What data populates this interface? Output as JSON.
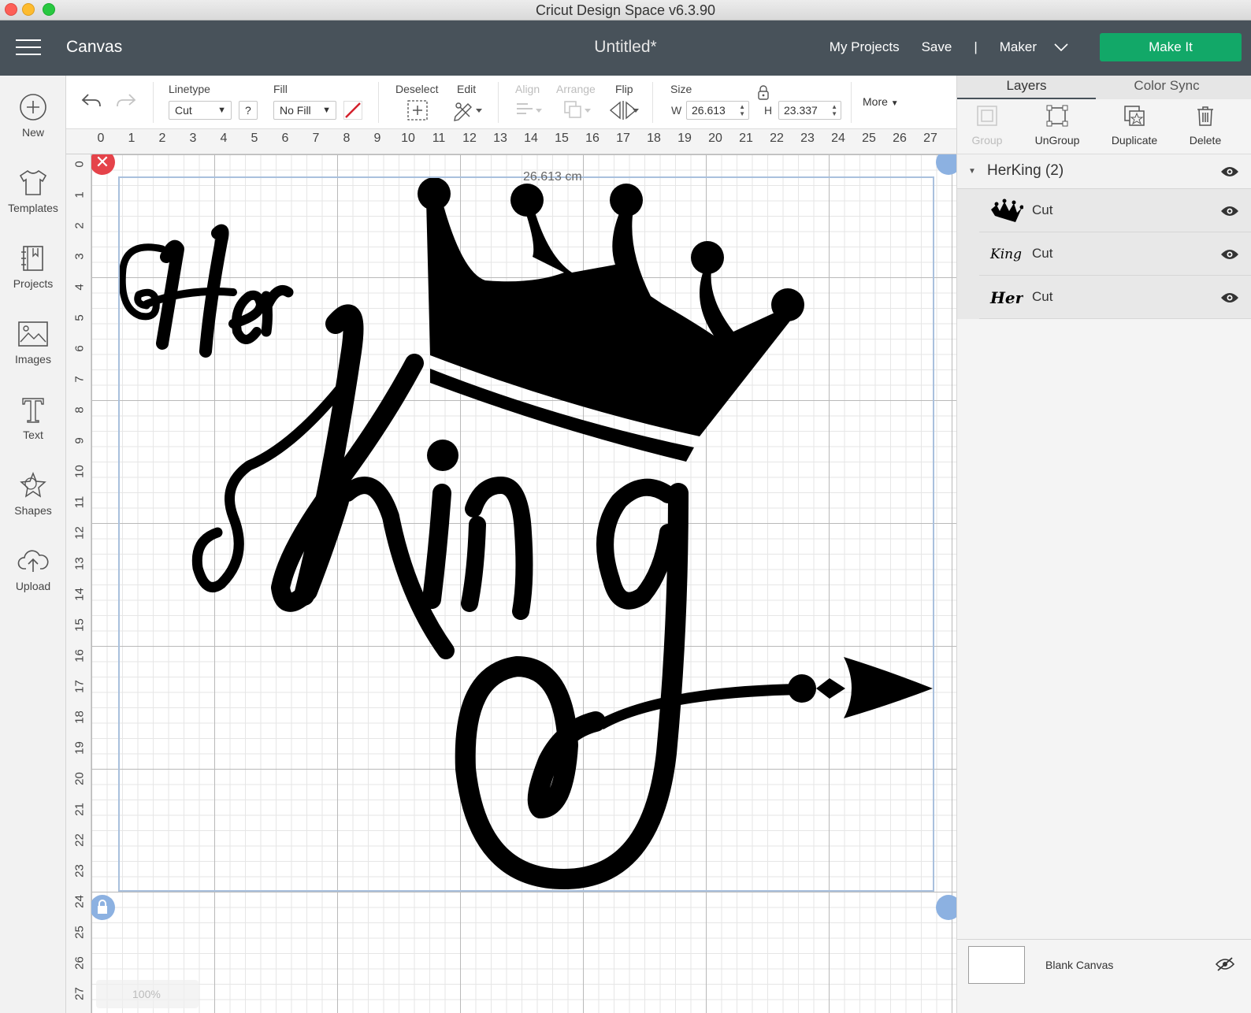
{
  "window": {
    "title": "Cricut Design Space  v6.3.90"
  },
  "header": {
    "section": "Canvas",
    "doc_title": "Untitled*",
    "my_projects": "My Projects",
    "save": "Save",
    "separator": "|",
    "machine": "Maker",
    "make_it": "Make It"
  },
  "leftnav": [
    {
      "label": "New",
      "icon": "plus-circle-icon"
    },
    {
      "label": "Templates",
      "icon": "tshirt-icon"
    },
    {
      "label": "Projects",
      "icon": "projects-icon"
    },
    {
      "label": "Images",
      "icon": "image-icon"
    },
    {
      "label": "Text",
      "icon": "text-icon"
    },
    {
      "label": "Shapes",
      "icon": "shapes-icon"
    },
    {
      "label": "Upload",
      "icon": "upload-cloud-icon"
    }
  ],
  "toolbar": {
    "linetype_label": "Linetype",
    "linetype_value": "Cut",
    "help": "?",
    "fill_label": "Fill",
    "fill_value": "No Fill",
    "deselect": "Deselect",
    "edit": "Edit",
    "align": "Align",
    "arrange": "Arrange",
    "flip": "Flip",
    "size": "Size",
    "w_label": "W",
    "w_value": "26.613",
    "h_label": "H",
    "h_value": "23.337",
    "more": "More"
  },
  "rulers": {
    "top": [
      "0",
      "1",
      "2",
      "3",
      "4",
      "5",
      "6",
      "7",
      "8",
      "9",
      "10",
      "11",
      "12",
      "13",
      "14",
      "15",
      "16",
      "17",
      "18",
      "19",
      "20",
      "21",
      "22",
      "23",
      "24",
      "25",
      "26",
      "27"
    ],
    "left": [
      "0",
      "1",
      "2",
      "3",
      "4",
      "5",
      "6",
      "7",
      "8",
      "9",
      "10",
      "11",
      "12",
      "13",
      "14",
      "15",
      "16",
      "17",
      "18",
      "19",
      "20",
      "21",
      "22",
      "23",
      "24",
      "25",
      "26",
      "27"
    ]
  },
  "canvas": {
    "dimension_label": "26.613 cm",
    "zoom": "100%",
    "artwork_text": [
      "Her",
      "King"
    ]
  },
  "rightpanel": {
    "tabs": [
      "Layers",
      "Color Sync"
    ],
    "actions": {
      "group": "Group",
      "ungroup": "UnGroup",
      "duplicate": "Duplicate",
      "delete": "Delete"
    },
    "group_name": "HerKing (2)",
    "layers": [
      {
        "name": "Cut",
        "thumb": "crown"
      },
      {
        "name": "Cut",
        "thumb": "King"
      },
      {
        "name": "Cut",
        "thumb": "Her"
      }
    ],
    "blank_canvas": "Blank Canvas"
  },
  "colors": {
    "header": "#48525a",
    "make_it": "#12a868",
    "selection": "#a9c0dd",
    "delete_handle": "#e5434a"
  }
}
